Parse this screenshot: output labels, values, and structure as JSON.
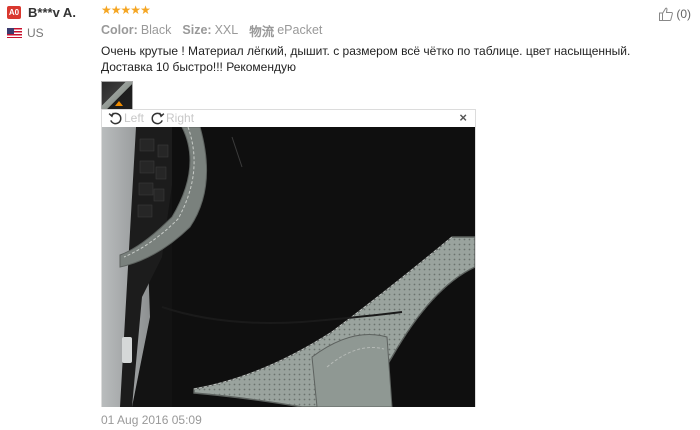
{
  "buyer": {
    "badge": "A0",
    "name": "B***v A.",
    "country": "US"
  },
  "review": {
    "rating": 5,
    "stars": [
      "★",
      "★",
      "★",
      "★",
      "★"
    ],
    "like_count": "(0)",
    "attributes": [
      {
        "label": "Color:",
        "value": "Black"
      },
      {
        "label": "Size:",
        "value": "XXL"
      },
      {
        "label": "物流",
        "value": "ePacket"
      }
    ],
    "text_line1": "Очень крутые ! Материал лёгкий, дышит. с размером всё чётко по таблице. цвет насыщенный.",
    "text_line2": "Доставка 10 быстро!!! Рекомендую",
    "date": "01 Aug 2016 05:09"
  },
  "viewer": {
    "rotate_left_label": "Left",
    "rotate_right_label": "Right",
    "close_symbol": "×"
  },
  "colors": {
    "accent_star": "#f5a623",
    "badge_red": "#d9382f",
    "muted": "#999999"
  }
}
